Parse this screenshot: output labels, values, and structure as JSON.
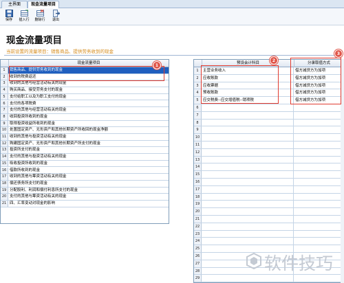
{
  "tabs": [
    {
      "label": "主界面"
    },
    {
      "label": "现金流量项目"
    }
  ],
  "toolbar": {
    "buttons": [
      {
        "label": "保存",
        "icon": "save-icon"
      },
      {
        "label": "插入行",
        "icon": "insert-row-icon"
      },
      {
        "label": "删除行",
        "icon": "delete-row-icon"
      },
      {
        "label": "退出",
        "icon": "exit-icon"
      }
    ]
  },
  "header": {
    "title": "现金流量项目",
    "subtitle": "当前设置的流量项目：销售商品、提供劳务收到的现金"
  },
  "left_grid": {
    "column_header": "现金流量项目",
    "rows": [
      "销售商品、提供劳务收到的现金",
      "收到的税费返还",
      "收到的其他与经营活动有关的现金",
      "购买商品、接受劳务支付的现金",
      "支付给职工以及为职工支付的现金",
      "支付的各项税费",
      "支付的其他与经营活动有关的现金",
      "收回投资所收到的现金",
      "取得投资收益所收到的现金",
      "处置固定资产、无形资产和其他长期资产所收回的现金净额",
      "收到的其他与投资活动有关的现金",
      "购建固定资产、无形资产和其他长期资产所支付的现金",
      "投资所支付的现金",
      "支付的其他与投资活动有关的现金",
      "吸收投资所收到的现金",
      "借款所收到的现金",
      "收到的其他与筹资活动有关的现金",
      "偿还债务所支付的现金",
      "分配股利、利润和偿付利息所支付的现金",
      "支付的其他与筹资活动有关的现金",
      "四、汇率变动对现金的影响"
    ]
  },
  "right_grid": {
    "column_headers": [
      "预设会计科目",
      "分录取值方式"
    ],
    "rows": [
      {
        "account": "主营业务收入",
        "method": "借方减贷方为加项"
      },
      {
        "account": "应收账款",
        "method": "借方减贷方为加项"
      },
      {
        "account": "应收票据",
        "method": "借方减贷方为加项"
      },
      {
        "account": "预收账款",
        "method": "借方减贷方为加项"
      },
      {
        "account": "应交税费--应交增值税--销项税",
        "method": "借方减贷方为加项"
      }
    ],
    "row_count": 29
  },
  "annotations": [
    "1",
    "2",
    "3"
  ],
  "watermark": {
    "text": "软件技巧"
  },
  "colors": {
    "selection": "#1f5fbf",
    "accent_orange": "#d48a1a",
    "annotation_red": "#e03a2f"
  }
}
